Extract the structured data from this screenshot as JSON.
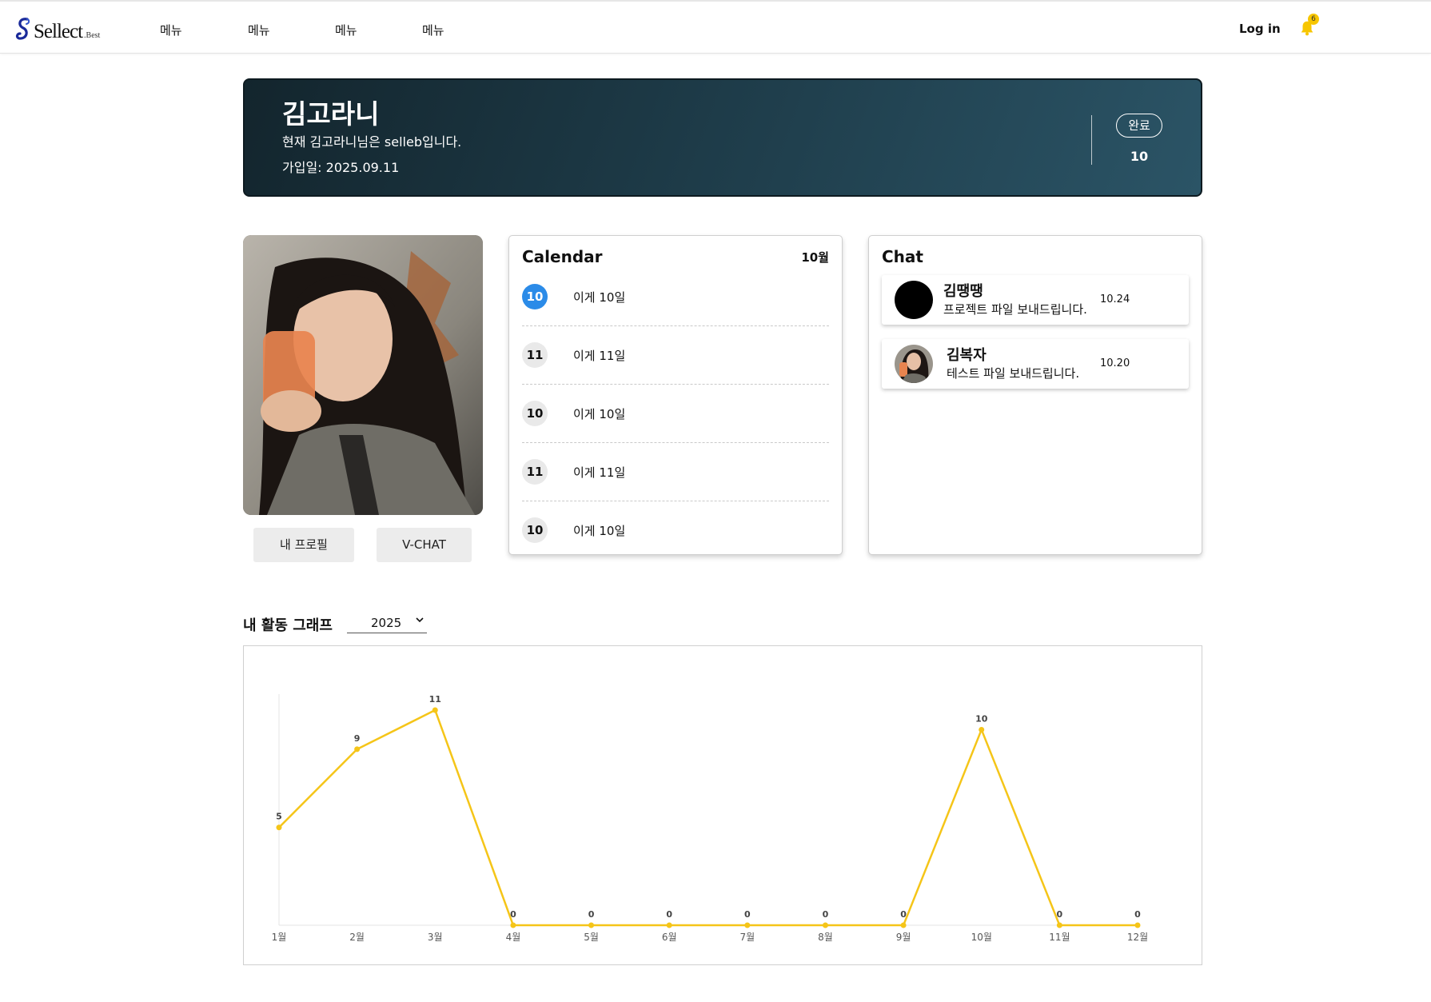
{
  "nav": {
    "logo_text": "Sellect",
    "logo_sub": ".Best",
    "menu": [
      "메뉴",
      "메뉴",
      "메뉴",
      "메뉴"
    ],
    "login_label": "Log in",
    "notification_count": "6",
    "bell_icon": "bell-icon",
    "accent_color": "#f7c600"
  },
  "banner": {
    "name": "김고라니",
    "status_text": "현재 김고라니님은 selleb입니다.",
    "join_date": "가입일: 2025.09.11",
    "badge_label": "완료",
    "badge_count": "10"
  },
  "profile": {
    "my_profile_button": "내 프로필",
    "vchat_button": "V-CHAT"
  },
  "calendar": {
    "title": "Calendar",
    "month": "10월",
    "items": [
      {
        "day": "10",
        "text": "이게 10일",
        "active": true
      },
      {
        "day": "11",
        "text": "이게 11일",
        "active": false
      },
      {
        "day": "10",
        "text": "이게 10일",
        "active": false
      },
      {
        "day": "11",
        "text": "이게 11일",
        "active": false
      },
      {
        "day": "10",
        "text": "이게 10일",
        "active": false
      }
    ],
    "active_color": "#2b8be8"
  },
  "chat": {
    "title": "Chat",
    "items": [
      {
        "name": "김땡땡",
        "message": "프로젝트 파일 보내드립니다.",
        "date": "10.24"
      },
      {
        "name": "김복자",
        "message": "테스트 파일 보내드립니다.",
        "date": "10.20"
      }
    ]
  },
  "graph": {
    "title": "내 활동 그래프",
    "year": "2025"
  },
  "chart_data": {
    "type": "line",
    "categories": [
      "1월",
      "2월",
      "3월",
      "4월",
      "5월",
      "6월",
      "7월",
      "8월",
      "9월",
      "10월",
      "11월",
      "12월"
    ],
    "values": [
      5,
      9,
      11,
      0,
      0,
      0,
      0,
      0,
      0,
      10,
      0,
      0
    ],
    "ylim": [
      0,
      12
    ],
    "line_color": "#f5c518",
    "grid": false,
    "data_labels": true
  }
}
